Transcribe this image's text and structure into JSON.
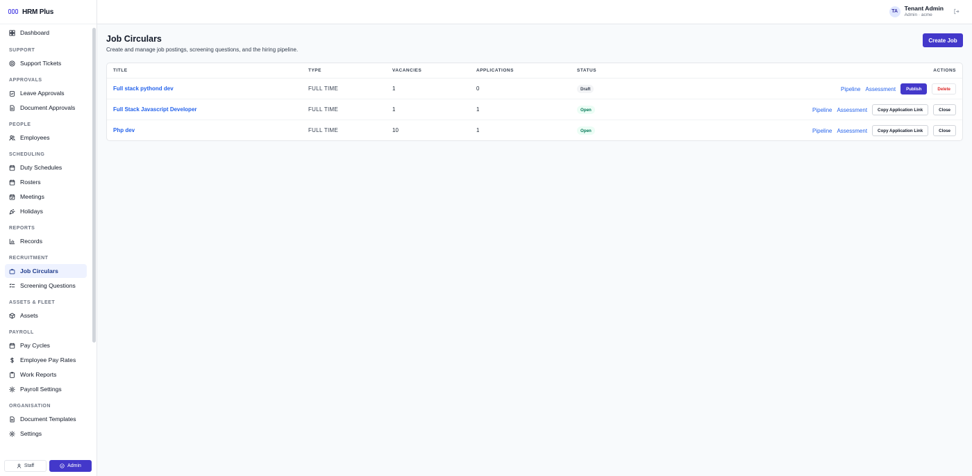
{
  "brand": {
    "name": "HRM Plus"
  },
  "sidebar": {
    "items": [
      {
        "type": "item",
        "label": "Dashboard",
        "icon": "dashboard-icon"
      },
      {
        "type": "section",
        "label": "SUPPORT"
      },
      {
        "type": "item",
        "label": "Support Tickets",
        "icon": "lifebuoy-icon"
      },
      {
        "type": "section",
        "label": "APPROVALS"
      },
      {
        "type": "item",
        "label": "Leave Approvals",
        "icon": "clipboard-check-icon"
      },
      {
        "type": "item",
        "label": "Document Approvals",
        "icon": "document-icon"
      },
      {
        "type": "section",
        "label": "PEOPLE"
      },
      {
        "type": "item",
        "label": "Employees",
        "icon": "users-icon"
      },
      {
        "type": "section",
        "label": "SCHEDULING"
      },
      {
        "type": "item",
        "label": "Duty Schedules",
        "icon": "calendar-icon"
      },
      {
        "type": "item",
        "label": "Rosters",
        "icon": "calendar-icon"
      },
      {
        "type": "item",
        "label": "Meetings",
        "icon": "calendar-check-icon"
      },
      {
        "type": "item",
        "label": "Holidays",
        "icon": "party-icon"
      },
      {
        "type": "section",
        "label": "REPORTS"
      },
      {
        "type": "item",
        "label": "Records",
        "icon": "bar-chart-icon"
      },
      {
        "type": "section",
        "label": "RECRUITMENT"
      },
      {
        "type": "item",
        "label": "Job Circulars",
        "icon": "briefcase-icon",
        "active": true
      },
      {
        "type": "item",
        "label": "Screening Questions",
        "icon": "list-check-icon"
      },
      {
        "type": "section",
        "label": "ASSETS & FLEET"
      },
      {
        "type": "item",
        "label": "Assets",
        "icon": "box-icon"
      },
      {
        "type": "section",
        "label": "PAYROLL"
      },
      {
        "type": "item",
        "label": "Pay Cycles",
        "icon": "calendar-icon"
      },
      {
        "type": "item",
        "label": "Employee Pay Rates",
        "icon": "dollar-icon"
      },
      {
        "type": "item",
        "label": "Work Reports",
        "icon": "clipboard-icon"
      },
      {
        "type": "item",
        "label": "Payroll Settings",
        "icon": "gear-icon"
      },
      {
        "type": "section",
        "label": "ORGANISATION"
      },
      {
        "type": "item",
        "label": "Document Templates",
        "icon": "document-icon"
      },
      {
        "type": "item",
        "label": "Settings",
        "icon": "gear-icon"
      }
    ],
    "mode": {
      "staff": "Staff",
      "admin": "Admin",
      "active": "admin"
    }
  },
  "user": {
    "initials": "TA",
    "name": "Tenant Admin",
    "sub": "Admin · acme"
  },
  "page": {
    "title": "Job Circulars",
    "subtitle": "Create and manage job postings, screening questions, and the hiring pipeline.",
    "create_label": "Create Job"
  },
  "table": {
    "headers": {
      "title": "TITLE",
      "type": "TYPE",
      "vacancies": "VACANCIES",
      "applications": "APPLICATIONS",
      "status": "STATUS",
      "actions": "ACTIONS"
    },
    "rows": [
      {
        "title": "Full stack pythond dev",
        "type": "FULL TIME",
        "vacancies": "1",
        "applications": "0",
        "status": "Draft",
        "status_kind": "draft",
        "actions": {
          "pipeline": "Pipeline",
          "assessment": "Assessment",
          "primary": "Publish",
          "secondary": "Delete"
        }
      },
      {
        "title": "Full Stack Javascript Developer",
        "type": "FULL TIME",
        "vacancies": "1",
        "applications": "1",
        "status": "Open",
        "status_kind": "open",
        "actions": {
          "pipeline": "Pipeline",
          "assessment": "Assessment",
          "primary": "Copy Application Link",
          "secondary": "Close"
        }
      },
      {
        "title": "Php dev",
        "type": "FULL TIME",
        "vacancies": "10",
        "applications": "1",
        "status": "Open",
        "status_kind": "open",
        "actions": {
          "pipeline": "Pipeline",
          "assessment": "Assessment",
          "primary": "Copy Application Link",
          "secondary": "Close"
        }
      }
    ]
  },
  "colors": {
    "accent": "#4338ca",
    "link": "#2563eb",
    "danger": "#dc2626",
    "open": "#047857"
  }
}
